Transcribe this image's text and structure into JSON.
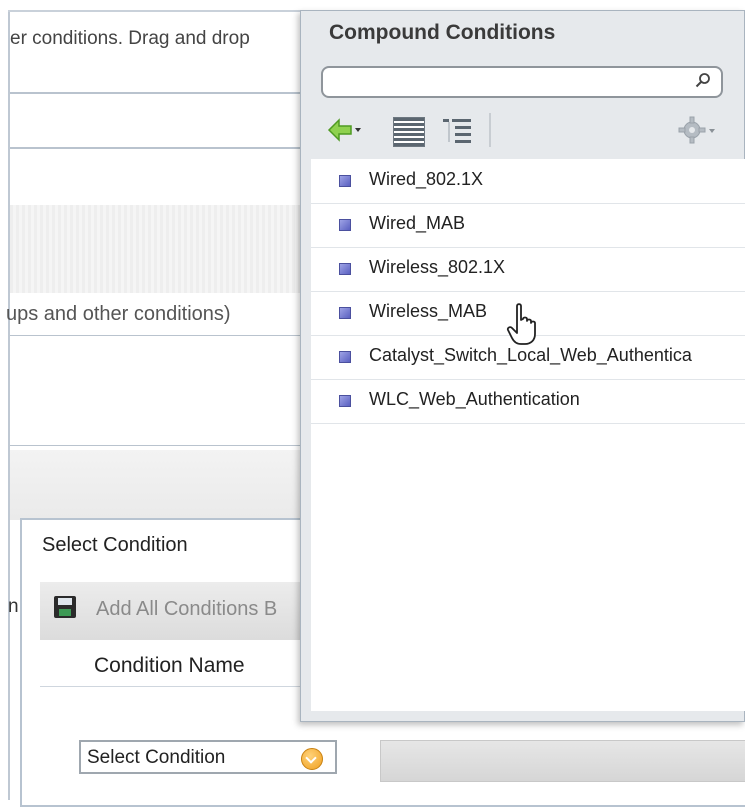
{
  "background": {
    "intro_text": "er conditions. Drag and drop",
    "helper_text": "ups and other conditions)",
    "left_fragment": "n"
  },
  "select_condition_panel": {
    "title": "Select Condition",
    "add_all_label": "Add All Conditions B",
    "column_header": "Condition Name",
    "select": {
      "label": "Select Condition"
    }
  },
  "compound_popup": {
    "title": "Compound Conditions",
    "search": {
      "value": "",
      "placeholder": ""
    },
    "toolbar": {
      "icons": [
        "back-arrow-icon",
        "list-view-icon",
        "tree-view-icon",
        "gear-icon"
      ]
    },
    "items": [
      {
        "label": "Wired_802.1X"
      },
      {
        "label": "Wired_MAB"
      },
      {
        "label": "Wireless_802.1X"
      },
      {
        "label": "Wireless_MAB"
      },
      {
        "label": "Catalyst_Switch_Local_Web_Authentica"
      },
      {
        "label": "WLC_Web_Authentication"
      }
    ]
  },
  "colors": {
    "accent_green": "#55b52f",
    "bullet_blue": "#5a60c0",
    "select_orange": "#f0a020",
    "popup_bg": "#e6e9ec"
  }
}
